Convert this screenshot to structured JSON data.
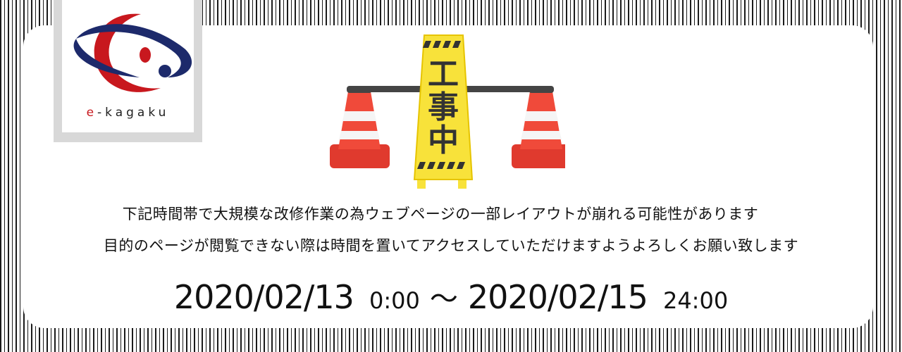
{
  "logo": {
    "brand_prefix": "e",
    "brand_rest": "-kagaku"
  },
  "sign": {
    "text": "工事中"
  },
  "notice": {
    "line1": "下記時間帯で大規模な改修作業の為ウェブページの一部レイアウトが崩れる可能性があります",
    "line2": "目的のページが閲覧できない際は時間を置いてアクセスしていただけますようよろしくお願い致します"
  },
  "schedule": {
    "start_date": "2020/02/13",
    "start_time": "0:00",
    "separator": "～",
    "end_date": "2020/02/15",
    "end_time": "24:00"
  },
  "colors": {
    "brand_red": "#c8181e",
    "brand_navy": "#1d2a6b",
    "cone_red": "#f04a3a",
    "sign_yellow": "#f8e23a"
  }
}
